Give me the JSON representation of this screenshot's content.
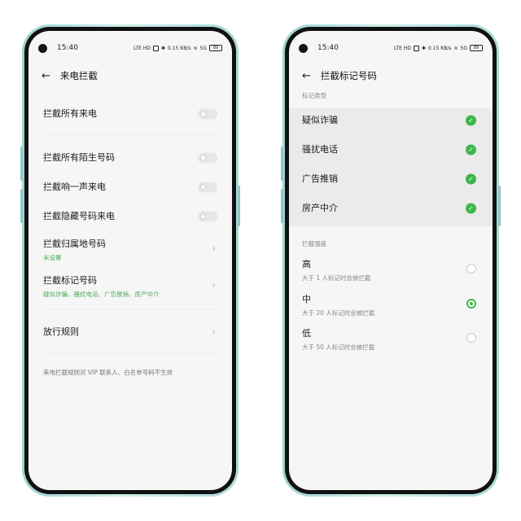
{
  "status": {
    "time": "15:40",
    "network": "LTE HD",
    "speed": "0.15 KB/s",
    "signal": "5G",
    "battery": "89"
  },
  "left": {
    "title": "来电拦截",
    "block_all": "拦截所有来电",
    "block_unknown": "拦截所有陌生号码",
    "block_one_ring": "拦截响一声来电",
    "block_hidden": "拦截隐藏号码来电",
    "block_region": {
      "label": "拦截归属地号码",
      "sub": "未设置"
    },
    "block_tagged": {
      "label": "拦截标记号码",
      "sub": "疑似诈骗、骚扰电话、广告推销、房产中介"
    },
    "allow_rules": "放行规则",
    "footnote": "来电拦截规则对 VIP 联系人、白名单号码不生效"
  },
  "right": {
    "title": "拦截标记号码",
    "tag_type_label": "标记类型",
    "tags": [
      {
        "label": "疑似诈骗",
        "checked": true
      },
      {
        "label": "骚扰电话",
        "checked": true
      },
      {
        "label": "广告推销",
        "checked": true
      },
      {
        "label": "房产中介",
        "checked": true
      }
    ],
    "strength_label": "拦截强度",
    "levels": [
      {
        "label": "高",
        "desc": "大于 1 人标记时会被拦截",
        "selected": false
      },
      {
        "label": "中",
        "desc": "大于 20 人标记时会被拦截",
        "selected": true
      },
      {
        "label": "低",
        "desc": "大于 50 人标记时会被拦截",
        "selected": false
      }
    ]
  },
  "colors": {
    "accent": "#3db74a",
    "frame": "#a9dad6"
  },
  "icons": {
    "back": "arrow-left-icon",
    "check": "check-circle-icon",
    "chevron": "chevron-right-icon"
  }
}
